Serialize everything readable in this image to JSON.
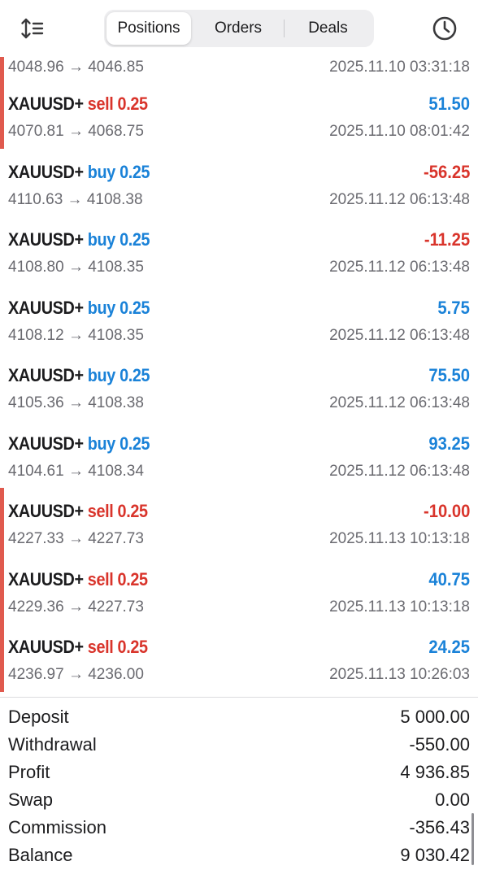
{
  "header": {
    "tabs": [
      {
        "label": "Positions"
      },
      {
        "label": "Orders"
      },
      {
        "label": "Deals"
      }
    ],
    "active_tab": "Positions",
    "left_icon": "sort-icon",
    "right_icon": "clock-icon"
  },
  "arrow": "→",
  "first_row": {
    "prices": "4048.96 → 4046.85",
    "time": "2025.11.10 03:31:18"
  },
  "deals": [
    {
      "symbol": "XAUUSD+",
      "type": "sell",
      "volume": "0.25",
      "profit": "51.50",
      "prices": "4070.81 → 4068.75",
      "time": "2025.11.10 08:01:42"
    },
    {
      "symbol": "XAUUSD+",
      "type": "buy",
      "volume": "0.25",
      "profit": "-56.25",
      "prices": "4110.63 → 4108.38",
      "time": "2025.11.12 06:13:48"
    },
    {
      "symbol": "XAUUSD+",
      "type": "buy",
      "volume": "0.25",
      "profit": "-11.25",
      "prices": "4108.80 → 4108.35",
      "time": "2025.11.12 06:13:48"
    },
    {
      "symbol": "XAUUSD+",
      "type": "buy",
      "volume": "0.25",
      "profit": "5.75",
      "prices": "4108.12 → 4108.35",
      "time": "2025.11.12 06:13:48"
    },
    {
      "symbol": "XAUUSD+",
      "type": "buy",
      "volume": "0.25",
      "profit": "75.50",
      "prices": "4105.36 → 4108.38",
      "time": "2025.11.12 06:13:48"
    },
    {
      "symbol": "XAUUSD+",
      "type": "buy",
      "volume": "0.25",
      "profit": "93.25",
      "prices": "4104.61 → 4108.34",
      "time": "2025.11.12 06:13:48"
    },
    {
      "symbol": "XAUUSD+",
      "type": "sell",
      "volume": "0.25",
      "profit": "-10.00",
      "prices": "4227.33 → 4227.73",
      "time": "2025.11.13 10:13:18"
    },
    {
      "symbol": "XAUUSD+",
      "type": "sell",
      "volume": "0.25",
      "profit": "40.75",
      "prices": "4229.36 → 4227.73",
      "time": "2025.11.13 10:13:18"
    },
    {
      "symbol": "XAUUSD+",
      "type": "sell",
      "volume": "0.25",
      "profit": "24.25",
      "prices": "4236.97 → 4236.00",
      "time": "2025.11.13 10:26:03"
    }
  ],
  "summary": [
    {
      "label": "Deposit",
      "value": "5 000.00"
    },
    {
      "label": "Withdrawal",
      "value": "-550.00"
    },
    {
      "label": "Profit",
      "value": "4 936.85"
    },
    {
      "label": "Swap",
      "value": "0.00"
    },
    {
      "label": "Commission",
      "value": "-356.43"
    },
    {
      "label": "Balance",
      "value": "9 030.42"
    }
  ],
  "colors": {
    "buy": "#1a82d8",
    "sell": "#d9342b",
    "sell_marker": "#e05a4e",
    "positive": "#1a82d8",
    "negative": "#d9342b"
  }
}
